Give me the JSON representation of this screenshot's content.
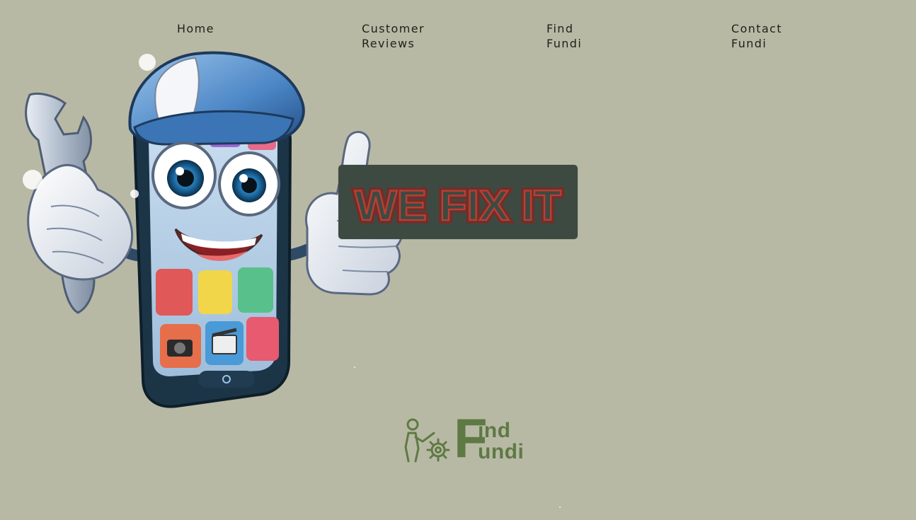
{
  "nav": {
    "home": "Home",
    "reviews_line1": "Customer",
    "reviews_line2": "Reviews",
    "find_line1": "Find",
    "find_line2": "Fundi",
    "contact_line1": "Contact",
    "contact_line2": "Fundi"
  },
  "banner": {
    "text": "WE FIX IT"
  },
  "logo": {
    "big_letter": "F",
    "word1": "ind",
    "word2": "undi"
  },
  "colors": {
    "background": "#b8b9a5",
    "banner_bg": "#3d4a42",
    "banner_text": "#b43a30",
    "logo": "#5e7a44",
    "nav_text": "#1f2019"
  },
  "mascot": {
    "icon": "phone-repair-mascot-icon"
  }
}
